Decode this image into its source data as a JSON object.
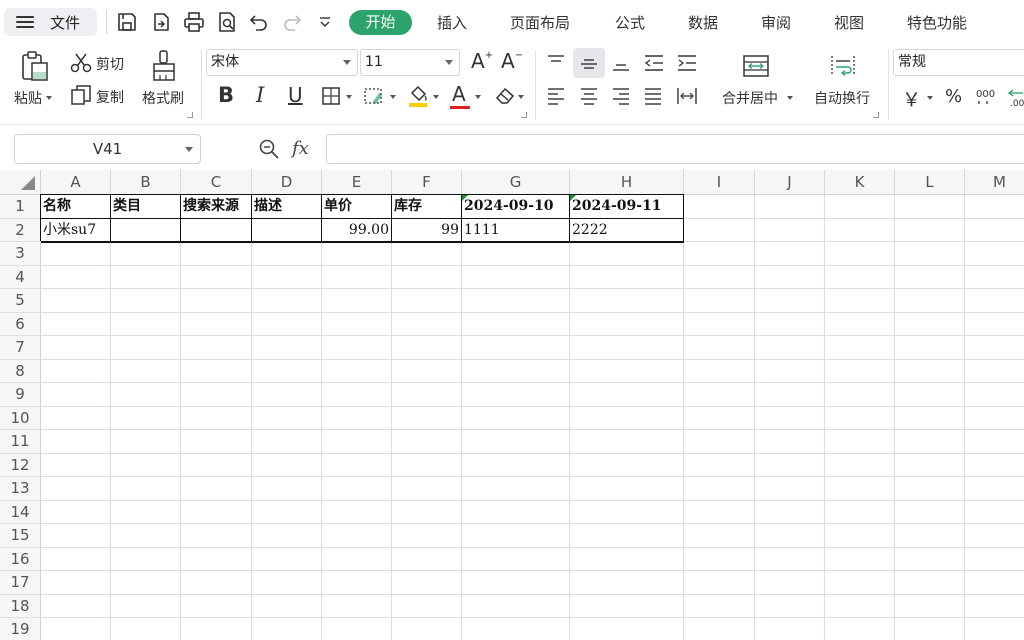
{
  "menubar": {
    "file_label": "文件",
    "tabs": [
      "开始",
      "插入",
      "页面布局",
      "公式",
      "数据",
      "审阅",
      "视图",
      "特色功能"
    ],
    "quick_icons": [
      "save-icon",
      "export-icon",
      "print-icon",
      "print-preview-icon",
      "undo-icon",
      "redo-icon",
      "customize-icon"
    ],
    "accent": "#2ba36a"
  },
  "ribbon": {
    "paste_label": "粘贴",
    "cut_label": "剪切",
    "copy_label": "复制",
    "format_painter_label": "格式刷",
    "font_name": "宋体",
    "font_size": "11",
    "merge_label": "合并居中",
    "wrap_label": "自动换行",
    "number_format": "常规",
    "currency_symbol": "￥",
    "percent_symbol": "%",
    "bold_glyph": "B",
    "italic_glyph": "I",
    "underline_glyph": "U",
    "grow_font": "A",
    "shrink_font": "A",
    "font_color_glyph": "A",
    "font_color": "#e02020"
  },
  "formulabar": {
    "name_box": "V41",
    "fx_label": "fx",
    "formula": ""
  },
  "sheet": {
    "columns": [
      "A",
      "B",
      "C",
      "D",
      "E",
      "F",
      "G",
      "H",
      "I",
      "J",
      "K",
      "L",
      "M"
    ],
    "rows": [
      "1",
      "2",
      "3",
      "4",
      "5",
      "6",
      "7",
      "8",
      "9",
      "10",
      "11",
      "12",
      "13",
      "14",
      "15",
      "16",
      "17",
      "18",
      "19"
    ],
    "header_row": [
      "名称",
      "类目",
      "搜索来源",
      "描述",
      "单价",
      "库存",
      "2024-09-10",
      "2024-09-11"
    ],
    "data_row": [
      "小米su7",
      "",
      "",
      "",
      "99.00",
      "99",
      "1111",
      "2222"
    ]
  }
}
